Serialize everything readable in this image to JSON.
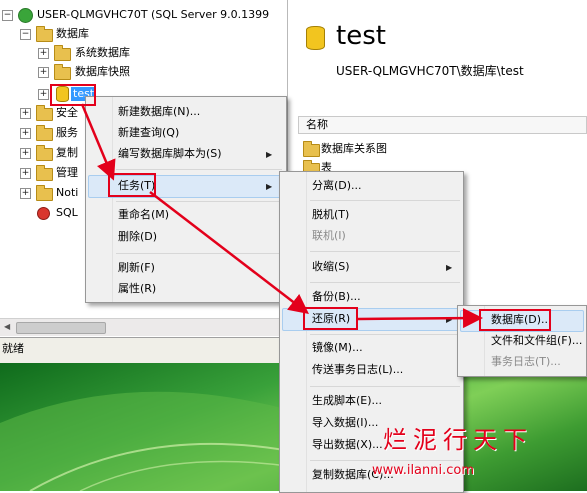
{
  "explorer": {
    "server": "USER-QLMGVHC70T (SQL Server 9.0.1399",
    "databases": "数据库",
    "system_databases": "系统数据库",
    "db_snapshots": "数据库快照",
    "test_db": "test",
    "security": "安全",
    "server_objects": "服务",
    "replication": "复制",
    "management": "管理",
    "notification": "Noti",
    "sql_agent": "SQL"
  },
  "status": {
    "text": "就绪"
  },
  "right_pane": {
    "title": "test",
    "path": "USER-QLMGVHC70T\\数据库\\test",
    "column_header": "名称",
    "items": [
      "数据库关系图",
      "表"
    ]
  },
  "context_menu": {
    "new_database": "新建数据库(N)...",
    "new_query": "新建查询(Q)",
    "script_as": "编写数据库脚本为(S)",
    "tasks": "任务(T)",
    "rename": "重命名(M)",
    "delete": "删除(D)",
    "refresh": "刷新(F)",
    "properties": "属性(R)"
  },
  "tasks_menu": {
    "detach": "分离(D)...",
    "take_offline": "脱机(T)",
    "bring_online": "联机(I)",
    "shrink": "收缩(S)",
    "backup": "备份(B)...",
    "restore": "还原(R)",
    "mirror": "镜像(M)...",
    "log_shipping": "传送事务日志(L)...",
    "generate_scripts": "生成脚本(E)...",
    "import_data": "导入数据(I)...",
    "export_data": "导出数据(X)...",
    "copy_database": "复制数据库(C)..."
  },
  "restore_menu": {
    "database": "数据库(D)...",
    "files": "文件和文件组(F)...",
    "transaction_log": "事务日志(T)..."
  },
  "watermark": {
    "brand": "烂泥行天下",
    "url": "www.ilanni.com"
  },
  "colors": {
    "highlight": "#cfe3f7",
    "red": "#e3001b",
    "desktop_green": "#3e9c32"
  }
}
